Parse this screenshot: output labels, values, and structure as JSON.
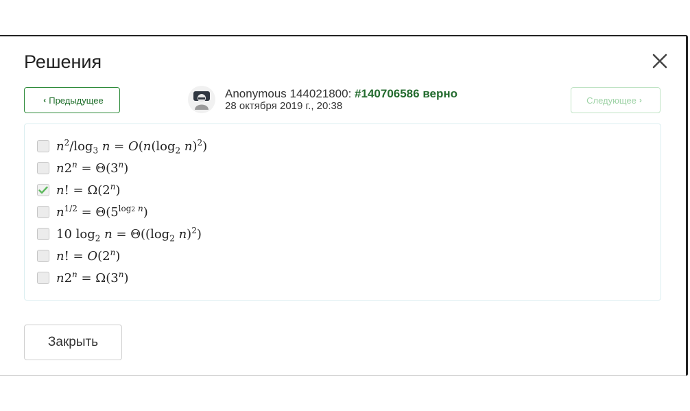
{
  "modal": {
    "title": "Решения",
    "close_icon": "close-icon"
  },
  "nav": {
    "prev_label": "Предыдущее",
    "next_label": "Следующее"
  },
  "author": {
    "name": "Anonymous 144021800: ",
    "solution_link": "#140706586 верно",
    "date": "28 октября 2019 г., 20:38"
  },
  "answers": [
    {
      "checked": false,
      "formula": "n^2 / log_3 n = O(n(log_2 n)^2)"
    },
    {
      "checked": false,
      "formula": "n2^n = Θ(3^n)"
    },
    {
      "checked": true,
      "formula": "n! = Ω(2^n)"
    },
    {
      "checked": false,
      "formula": "n^{1/2} = Θ(5^{log_2 n})"
    },
    {
      "checked": false,
      "formula": "10 log_2 n = Θ((log_2 n)^2)"
    },
    {
      "checked": false,
      "formula": "n! = O(2^n)"
    },
    {
      "checked": false,
      "formula": "n2^n = Ω(3^n)"
    }
  ],
  "footer": {
    "close_label": "Закрыть"
  },
  "colors": {
    "accent_green": "#236b2e",
    "checkmark": "#5cb85c"
  }
}
